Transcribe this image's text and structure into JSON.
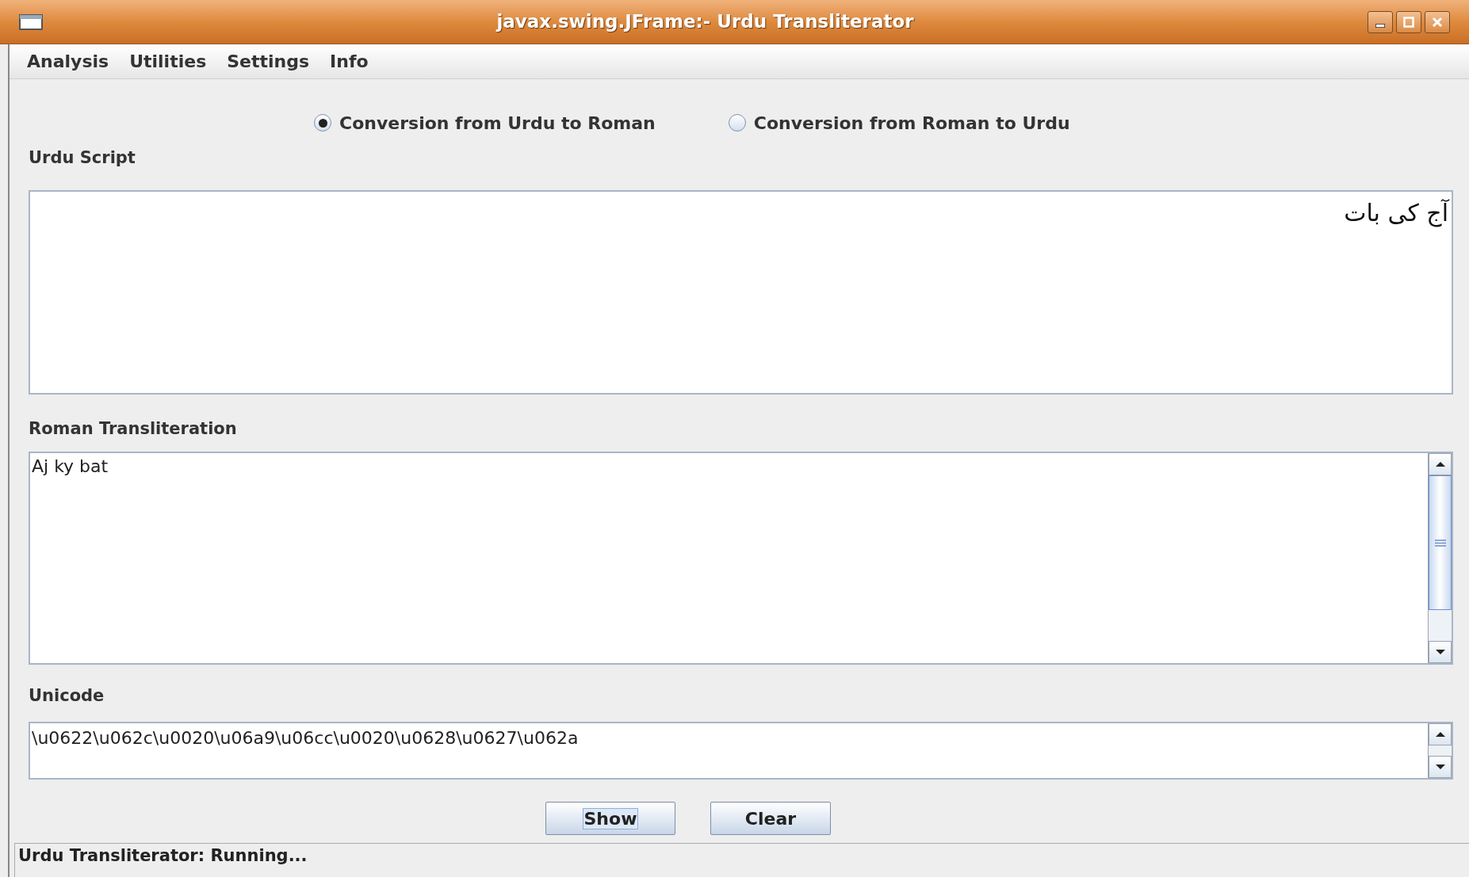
{
  "window": {
    "title": "javax.swing.JFrame:- Urdu Transliterator"
  },
  "menu": [
    "Analysis",
    "Utilities",
    "Settings",
    "Info"
  ],
  "modes": [
    {
      "label": "Conversion from Urdu to Roman",
      "selected": true
    },
    {
      "label": "Conversion from Roman to Urdu",
      "selected": false
    }
  ],
  "urdu_script": {
    "label": "Urdu Script",
    "value": "آج کی بات"
  },
  "roman_transliteration": {
    "label": "Roman Transliteration",
    "value": "Aj ky bat"
  },
  "unicode": {
    "label": "Unicode",
    "value": "\\u0622\\u062c\\u0020\\u06a9\\u06cc\\u0020\\u0628\\u0627\\u062a"
  },
  "buttons": [
    {
      "label": "Show",
      "focused": true
    },
    {
      "label": "Clear",
      "focused": false
    }
  ],
  "status_bar": "Urdu Transliterator: Running..."
}
